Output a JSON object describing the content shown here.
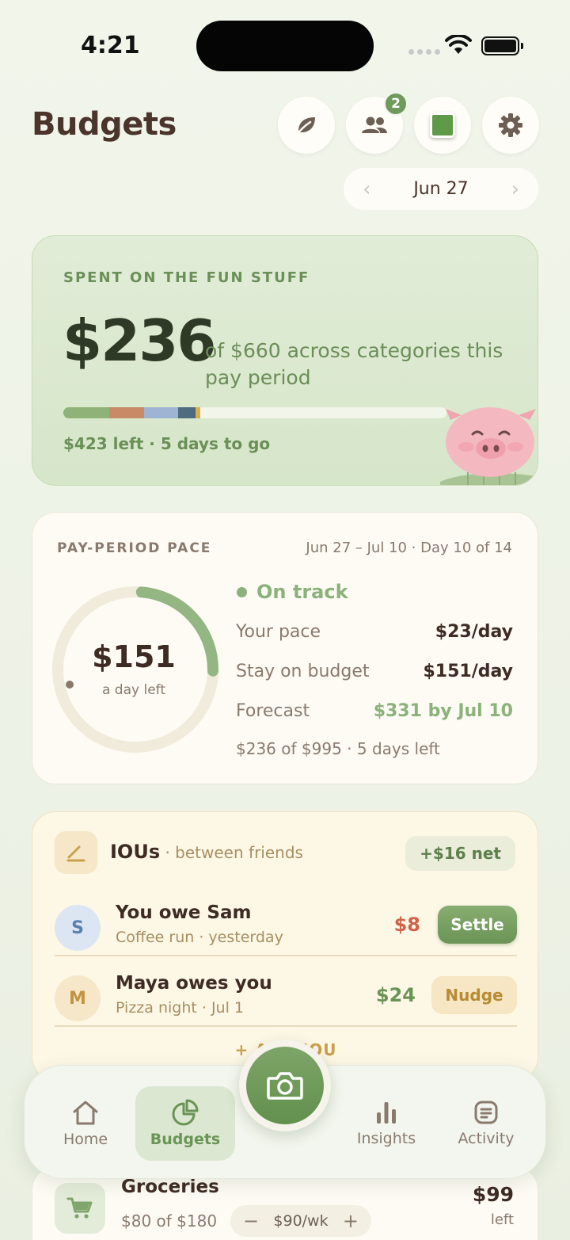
{
  "status_bar": {
    "time": "4:21"
  },
  "header": {
    "title": "Budgets",
    "friends_badge": "2",
    "date": "Jun 27",
    "icons": [
      "leaf-icon",
      "people-icon",
      "swatch-icon",
      "gear-icon"
    ]
  },
  "spent_card": {
    "eyebrow": "SPENT ON THE FUN STUFF",
    "amount": "$236",
    "description": "of $660 across categories this pay period",
    "progress_fraction": 0.358,
    "segments": [
      {
        "color": "#8fb278",
        "fraction": 0.12
      },
      {
        "color": "#c98a68",
        "fraction": 0.09
      },
      {
        "color": "#9fb4d2",
        "fraction": 0.09
      },
      {
        "color": "#4f6b80",
        "fraction": 0.045
      },
      {
        "color": "#d9b04e",
        "fraction": 0.013
      }
    ],
    "remaining": "$423 left · 5 days to go"
  },
  "pace_card": {
    "eyebrow": "PAY-PERIOD PACE",
    "range": "Jun 27 – Jul 10 · Day 10 of 14",
    "ring_amount": "$151",
    "ring_sub": "a day left",
    "ring_fraction": 0.24,
    "status": "On track",
    "rows": [
      {
        "label": "Your pace",
        "value": "$23/day"
      },
      {
        "label": "Stay on budget",
        "value": "$151/day"
      },
      {
        "label": "Forecast",
        "value": "$331 by Jul 10"
      }
    ],
    "footer": "$236 of $995 · 5 days left"
  },
  "iou_card": {
    "title": "IOUs",
    "subtitle": " · between friends",
    "net": "+$16 net",
    "rows": [
      {
        "initial": "S",
        "name": "You owe Sam",
        "meta": "Coffee run · yesterday",
        "amount": "$8",
        "action": "Settle"
      },
      {
        "initial": "M",
        "name": "Maya owes you",
        "meta": "Pizza night · Jul 1",
        "amount": "$24",
        "action": "Nudge"
      }
    ],
    "add_label": "+ ADD IOU"
  },
  "groceries_card": {
    "name": "Groceries",
    "meta": "$80 of $180",
    "stepper_value": "$90/wk",
    "minus": "−",
    "plus": "+",
    "amount": "$99",
    "amount_sub": "left"
  },
  "tabbar": {
    "tabs": [
      {
        "label": "Home",
        "icon": "home-icon"
      },
      {
        "label": "Budgets",
        "icon": "pie-chart-icon",
        "active": true
      },
      {
        "label": "Insights",
        "icon": "bar-chart-icon"
      },
      {
        "label": "Activity",
        "icon": "receipt-icon"
      }
    ],
    "center_icon": "camera-icon"
  },
  "colors": {
    "accent_green": "#6a9455",
    "text_brown": "#3e2b24",
    "owe_red": "#d0644a",
    "owed_green": "#6a9455"
  }
}
